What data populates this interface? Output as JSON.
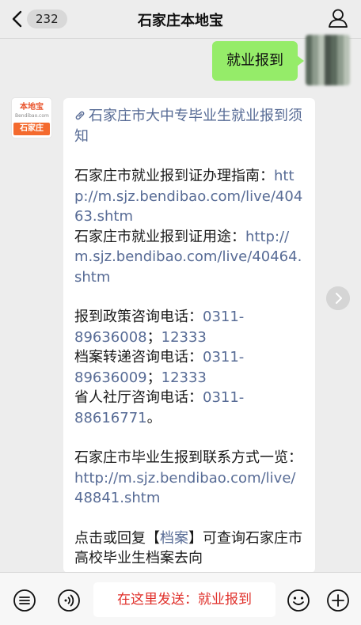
{
  "header": {
    "back_count": "232",
    "title": "石家庄本地宝"
  },
  "user_message": {
    "text": "就业报到"
  },
  "bot": {
    "avatar_top": "本地宝",
    "avatar_sub": "Bendibao.com",
    "avatar_bar": "石家庄",
    "article_link": "石家庄市大中专毕业生就业报到须知",
    "guide_label": "石家庄市就业报到证办理指南：",
    "guide_url": "http://m.sjz.bendibao.com/live/40463.shtm",
    "usage_label": "石家庄市就业报到证用途：",
    "usage_url": "http://m.sjz.bendibao.com/live/40464.shtm",
    "policy_label": "报到政策咨询电话：",
    "policy_phone": "0311-89636008",
    "policy_sep": "；",
    "policy_phone2": "12333",
    "archive_label": "档案转递咨询电话：",
    "archive_phone": "0311-89636009",
    "archive_sep": "；",
    "archive_phone2": "12333",
    "prov_label": "省人社厅咨询电话：",
    "prov_phone": "0311-88616771",
    "prov_end": "。",
    "contact_label": "石家庄市毕业生报到联系方式一览：",
    "contact_url": "http://m.sjz.bendibao.com/live/48841.shtm",
    "reply_pre": "点击或回复【",
    "reply_kw": "档案",
    "reply_post": "】可查询石家庄市高校毕业生档案去向"
  },
  "input": {
    "text": "在这里发送：就业报到"
  },
  "icons": [
    "back-chevron-icon",
    "profile-icon",
    "link-icon",
    "menu-icon",
    "voice-icon",
    "emoji-icon",
    "plus-icon",
    "chevron-right-icon"
  ]
}
